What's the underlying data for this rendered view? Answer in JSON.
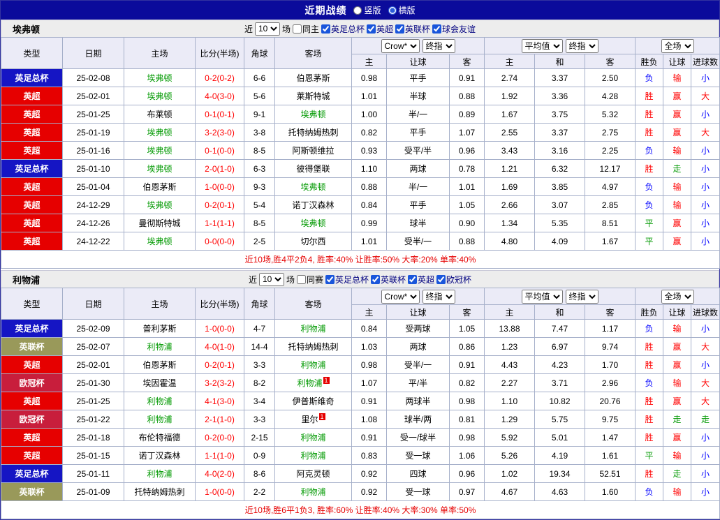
{
  "titlebar": {
    "title": "近期战绩",
    "view_options": [
      {
        "label": "竖版",
        "checked": false
      },
      {
        "label": "横版",
        "checked": true
      }
    ]
  },
  "badge_colors": {
    "英足总杯": "#1515c4",
    "英超": "#e60000",
    "英联杯": "#99995a",
    "欧冠杯": "#c81e3c"
  },
  "result_colors": {
    "r": "#ff0000",
    "g": "#009900",
    "b": "#0000ff"
  },
  "table_header": {
    "col_type": "类型",
    "col_date": "日期",
    "col_home": "主场",
    "col_score": "比分(半场)",
    "col_corner": "角球",
    "col_away": "客场",
    "odds_group1": {
      "select1": "Crow*",
      "select2": "终指",
      "cols": [
        "主",
        "让球",
        "客"
      ]
    },
    "odds_group2": {
      "select1": "平均值",
      "select2": "终指",
      "cols": [
        "主",
        "和",
        "客"
      ]
    },
    "odds_group3": {
      "select1": "全场",
      "cols": [
        "胜负",
        "让球",
        "进球数"
      ]
    }
  },
  "sections": [
    {
      "team": "埃弗顿",
      "filter": {
        "near_label": "近",
        "count": "10",
        "matches_label": "场",
        "same_label": "同主",
        "same_checked": false,
        "competitions": [
          {
            "label": "英足总杯",
            "checked": true
          },
          {
            "label": "英超",
            "checked": true
          },
          {
            "label": "英联杯",
            "checked": true
          },
          {
            "label": "球会友谊",
            "checked": true
          }
        ]
      },
      "rows": [
        {
          "type": "英足总杯",
          "date": "25-02-08",
          "home": "埃弗顿",
          "home_focus": true,
          "score": "0-2(0-2)",
          "corner": "6-6",
          "away": "伯恩茅斯",
          "odds": [
            "0.98",
            "平手",
            "0.91"
          ],
          "avg": [
            "2.74",
            "3.37",
            "2.50"
          ],
          "results": [
            {
              "t": "负",
              "c": "b"
            },
            {
              "t": "输",
              "c": "r"
            },
            {
              "t": "小",
              "c": "b"
            }
          ]
        },
        {
          "type": "英超",
          "date": "25-02-01",
          "home": "埃弗顿",
          "home_focus": true,
          "score": "4-0(3-0)",
          "corner": "5-6",
          "away": "莱斯特城",
          "odds": [
            "1.01",
            "半球",
            "0.88"
          ],
          "avg": [
            "1.92",
            "3.36",
            "4.28"
          ],
          "results": [
            {
              "t": "胜",
              "c": "r"
            },
            {
              "t": "赢",
              "c": "r"
            },
            {
              "t": "大",
              "c": "r"
            }
          ]
        },
        {
          "type": "英超",
          "date": "25-01-25",
          "home": "布莱顿",
          "score": "0-1(0-1)",
          "corner": "9-1",
          "away": "埃弗顿",
          "away_focus": true,
          "odds": [
            "1.00",
            "半/一",
            "0.89"
          ],
          "avg": [
            "1.67",
            "3.75",
            "5.32"
          ],
          "results": [
            {
              "t": "胜",
              "c": "r"
            },
            {
              "t": "赢",
              "c": "r"
            },
            {
              "t": "小",
              "c": "b"
            }
          ]
        },
        {
          "type": "英超",
          "date": "25-01-19",
          "home": "埃弗顿",
          "home_focus": true,
          "score": "3-2(3-0)",
          "corner": "3-8",
          "away": "托特纳姆热刺",
          "odds": [
            "0.82",
            "平手",
            "1.07"
          ],
          "avg": [
            "2.55",
            "3.37",
            "2.75"
          ],
          "results": [
            {
              "t": "胜",
              "c": "r"
            },
            {
              "t": "赢",
              "c": "r"
            },
            {
              "t": "大",
              "c": "r"
            }
          ]
        },
        {
          "type": "英超",
          "date": "25-01-16",
          "home": "埃弗顿",
          "home_focus": true,
          "score": "0-1(0-0)",
          "corner": "8-5",
          "away": "阿斯顿维拉",
          "odds": [
            "0.93",
            "受平/半",
            "0.96"
          ],
          "avg": [
            "3.43",
            "3.16",
            "2.25"
          ],
          "results": [
            {
              "t": "负",
              "c": "b"
            },
            {
              "t": "输",
              "c": "r"
            },
            {
              "t": "小",
              "c": "b"
            }
          ]
        },
        {
          "type": "英足总杯",
          "date": "25-01-10",
          "home": "埃弗顿",
          "home_focus": true,
          "score": "2-0(1-0)",
          "corner": "6-3",
          "away": "彼得堡联",
          "odds": [
            "1.10",
            "两球",
            "0.78"
          ],
          "avg": [
            "1.21",
            "6.32",
            "12.17"
          ],
          "results": [
            {
              "t": "胜",
              "c": "r"
            },
            {
              "t": "走",
              "c": "g"
            },
            {
              "t": "小",
              "c": "b"
            }
          ]
        },
        {
          "type": "英超",
          "date": "25-01-04",
          "home": "伯恩茅斯",
          "score": "1-0(0-0)",
          "corner": "9-3",
          "away": "埃弗顿",
          "away_focus": true,
          "odds": [
            "0.88",
            "半/一",
            "1.01"
          ],
          "avg": [
            "1.69",
            "3.85",
            "4.97"
          ],
          "results": [
            {
              "t": "负",
              "c": "b"
            },
            {
              "t": "输",
              "c": "r"
            },
            {
              "t": "小",
              "c": "b"
            }
          ]
        },
        {
          "type": "英超",
          "date": "24-12-29",
          "home": "埃弗顿",
          "home_focus": true,
          "score": "0-2(0-1)",
          "corner": "5-4",
          "away": "诺丁汉森林",
          "odds": [
            "0.84",
            "平手",
            "1.05"
          ],
          "avg": [
            "2.66",
            "3.07",
            "2.85"
          ],
          "results": [
            {
              "t": "负",
              "c": "b"
            },
            {
              "t": "输",
              "c": "r"
            },
            {
              "t": "小",
              "c": "b"
            }
          ]
        },
        {
          "type": "英超",
          "date": "24-12-26",
          "home": "曼彻斯特城",
          "score": "1-1(1-1)",
          "corner": "8-5",
          "away": "埃弗顿",
          "away_focus": true,
          "odds": [
            "0.99",
            "球半",
            "0.90"
          ],
          "avg": [
            "1.34",
            "5.35",
            "8.51"
          ],
          "results": [
            {
              "t": "平",
              "c": "g"
            },
            {
              "t": "赢",
              "c": "r"
            },
            {
              "t": "小",
              "c": "b"
            }
          ]
        },
        {
          "type": "英超",
          "date": "24-12-22",
          "home": "埃弗顿",
          "home_focus": true,
          "score": "0-0(0-0)",
          "corner": "2-5",
          "away": "切尔西",
          "odds": [
            "1.01",
            "受半/一",
            "0.88"
          ],
          "avg": [
            "4.80",
            "4.09",
            "1.67"
          ],
          "results": [
            {
              "t": "平",
              "c": "g"
            },
            {
              "t": "赢",
              "c": "r"
            },
            {
              "t": "小",
              "c": "b"
            }
          ]
        }
      ],
      "summary": "近10场,胜4平2负4, 胜率:40% 让胜率:50% 大率:20% 单率:40%"
    },
    {
      "team": "利物浦",
      "filter": {
        "near_label": "近",
        "count": "10",
        "matches_label": "场",
        "same_label": "同赛",
        "same_checked": false,
        "competitions": [
          {
            "label": "英足总杯",
            "checked": true
          },
          {
            "label": "英联杯",
            "checked": true
          },
          {
            "label": "英超",
            "checked": true
          },
          {
            "label": "欧冠杯",
            "checked": true
          }
        ]
      },
      "rows": [
        {
          "type": "英足总杯",
          "date": "25-02-09",
          "home": "普利茅斯",
          "score": "1-0(0-0)",
          "corner": "4-7",
          "away": "利物浦",
          "away_focus": true,
          "odds": [
            "0.84",
            "受两球",
            "1.05"
          ],
          "avg": [
            "13.88",
            "7.47",
            "1.17"
          ],
          "results": [
            {
              "t": "负",
              "c": "b"
            },
            {
              "t": "输",
              "c": "r"
            },
            {
              "t": "小",
              "c": "b"
            }
          ]
        },
        {
          "type": "英联杯",
          "date": "25-02-07",
          "home": "利物浦",
          "home_focus": true,
          "score": "4-0(1-0)",
          "corner": "14-4",
          "away": "托特纳姆热刺",
          "odds": [
            "1.03",
            "两球",
            "0.86"
          ],
          "avg": [
            "1.23",
            "6.97",
            "9.74"
          ],
          "results": [
            {
              "t": "胜",
              "c": "r"
            },
            {
              "t": "赢",
              "c": "r"
            },
            {
              "t": "大",
              "c": "r"
            }
          ]
        },
        {
          "type": "英超",
          "date": "25-02-01",
          "home": "伯恩茅斯",
          "score": "0-2(0-1)",
          "corner": "3-3",
          "away": "利物浦",
          "away_focus": true,
          "odds": [
            "0.98",
            "受半/一",
            "0.91"
          ],
          "avg": [
            "4.43",
            "4.23",
            "1.70"
          ],
          "results": [
            {
              "t": "胜",
              "c": "r"
            },
            {
              "t": "赢",
              "c": "r"
            },
            {
              "t": "小",
              "c": "b"
            }
          ]
        },
        {
          "type": "欧冠杯",
          "date": "25-01-30",
          "home": "埃因霍温",
          "score": "3-2(3-2)",
          "corner": "8-2",
          "away": "利物浦",
          "away_focus": true,
          "away_rc": "1",
          "odds": [
            "1.07",
            "平/半",
            "0.82"
          ],
          "avg": [
            "2.27",
            "3.71",
            "2.96"
          ],
          "results": [
            {
              "t": "负",
              "c": "b"
            },
            {
              "t": "输",
              "c": "r"
            },
            {
              "t": "大",
              "c": "r"
            }
          ]
        },
        {
          "type": "英超",
          "date": "25-01-25",
          "home": "利物浦",
          "home_focus": true,
          "score": "4-1(3-0)",
          "corner": "3-4",
          "away": "伊普斯维奇",
          "odds": [
            "0.91",
            "两球半",
            "0.98"
          ],
          "avg": [
            "1.10",
            "10.82",
            "20.76"
          ],
          "results": [
            {
              "t": "胜",
              "c": "r"
            },
            {
              "t": "赢",
              "c": "r"
            },
            {
              "t": "大",
              "c": "r"
            }
          ]
        },
        {
          "type": "欧冠杯",
          "date": "25-01-22",
          "home": "利物浦",
          "home_focus": true,
          "score": "2-1(1-0)",
          "corner": "3-3",
          "away": "里尔",
          "away_rc": "1",
          "odds": [
            "1.08",
            "球半/两",
            "0.81"
          ],
          "avg": [
            "1.29",
            "5.75",
            "9.75"
          ],
          "results": [
            {
              "t": "胜",
              "c": "r"
            },
            {
              "t": "走",
              "c": "g"
            },
            {
              "t": "走",
              "c": "g"
            }
          ]
        },
        {
          "type": "英超",
          "date": "25-01-18",
          "home": "布伦特福德",
          "score": "0-2(0-0)",
          "corner": "2-15",
          "away": "利物浦",
          "away_focus": true,
          "odds": [
            "0.91",
            "受一/球半",
            "0.98"
          ],
          "avg": [
            "5.92",
            "5.01",
            "1.47"
          ],
          "results": [
            {
              "t": "胜",
              "c": "r"
            },
            {
              "t": "赢",
              "c": "r"
            },
            {
              "t": "小",
              "c": "b"
            }
          ]
        },
        {
          "type": "英超",
          "date": "25-01-15",
          "home": "诺丁汉森林",
          "score": "1-1(1-0)",
          "corner": "0-9",
          "away": "利物浦",
          "away_focus": true,
          "odds": [
            "0.83",
            "受一球",
            "1.06"
          ],
          "avg": [
            "5.26",
            "4.19",
            "1.61"
          ],
          "results": [
            {
              "t": "平",
              "c": "g"
            },
            {
              "t": "输",
              "c": "r"
            },
            {
              "t": "小",
              "c": "b"
            }
          ]
        },
        {
          "type": "英足总杯",
          "date": "25-01-11",
          "home": "利物浦",
          "home_focus": true,
          "score": "4-0(2-0)",
          "corner": "8-6",
          "away": "阿克灵顿",
          "odds": [
            "0.92",
            "四球",
            "0.96"
          ],
          "avg": [
            "1.02",
            "19.34",
            "52.51"
          ],
          "results": [
            {
              "t": "胜",
              "c": "r"
            },
            {
              "t": "走",
              "c": "g"
            },
            {
              "t": "小",
              "c": "b"
            }
          ]
        },
        {
          "type": "英联杯",
          "date": "25-01-09",
          "home": "托特纳姆热刺",
          "score": "1-0(0-0)",
          "corner": "2-2",
          "away": "利物浦",
          "away_focus": true,
          "odds": [
            "0.92",
            "受一球",
            "0.97"
          ],
          "avg": [
            "4.67",
            "4.63",
            "1.60"
          ],
          "results": [
            {
              "t": "负",
              "c": "b"
            },
            {
              "t": "输",
              "c": "r"
            },
            {
              "t": "小",
              "c": "b"
            }
          ]
        }
      ],
      "summary": "近10场,胜6平1负3, 胜率:60% 让胜率:40% 大率:30% 单率:50%"
    }
  ]
}
